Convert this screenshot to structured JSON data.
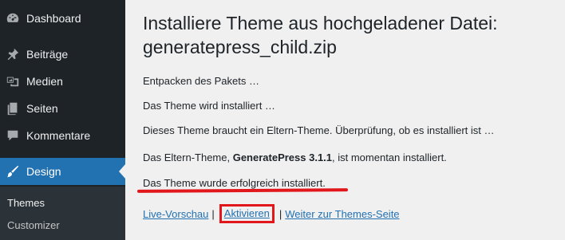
{
  "sidebar": {
    "items": [
      {
        "label": "Dashboard",
        "icon": "dashboard-icon"
      },
      {
        "label": "Beiträge",
        "icon": "pin-icon"
      },
      {
        "label": "Medien",
        "icon": "media-icon"
      },
      {
        "label": "Seiten",
        "icon": "pages-icon"
      },
      {
        "label": "Kommentare",
        "icon": "comment-icon"
      },
      {
        "label": "Design",
        "icon": "brush-icon",
        "active": true
      }
    ],
    "submenu": [
      {
        "label": "Themes"
      },
      {
        "label": "Customizer"
      }
    ]
  },
  "main": {
    "title": "Installiere Theme aus hochgeladener Datei: generatepress_child.zip",
    "messages": {
      "unpack": "Entpacken des Pakets …",
      "installing": "Das Theme wird installiert …",
      "needs_parent": "Dieses Theme braucht ein Eltern-Theme. Überprüfung, ob es installiert ist …",
      "parent_prefix": "Das Eltern-Theme, ",
      "parent_name": "GeneratePress 3.1.1",
      "parent_suffix": ", ist momentan installiert.",
      "success": "Das Theme wurde erfolgreich installiert."
    },
    "links": {
      "live_preview": "Live-Vorschau",
      "separator": "|",
      "activate": "Aktivieren",
      "themes_page": "Weiter zur Themes-Seite"
    }
  },
  "colors": {
    "sidebar_bg": "#1d2327",
    "active_bg": "#2271b1",
    "link": "#2271b1",
    "annotation_red": "#e2171c"
  }
}
